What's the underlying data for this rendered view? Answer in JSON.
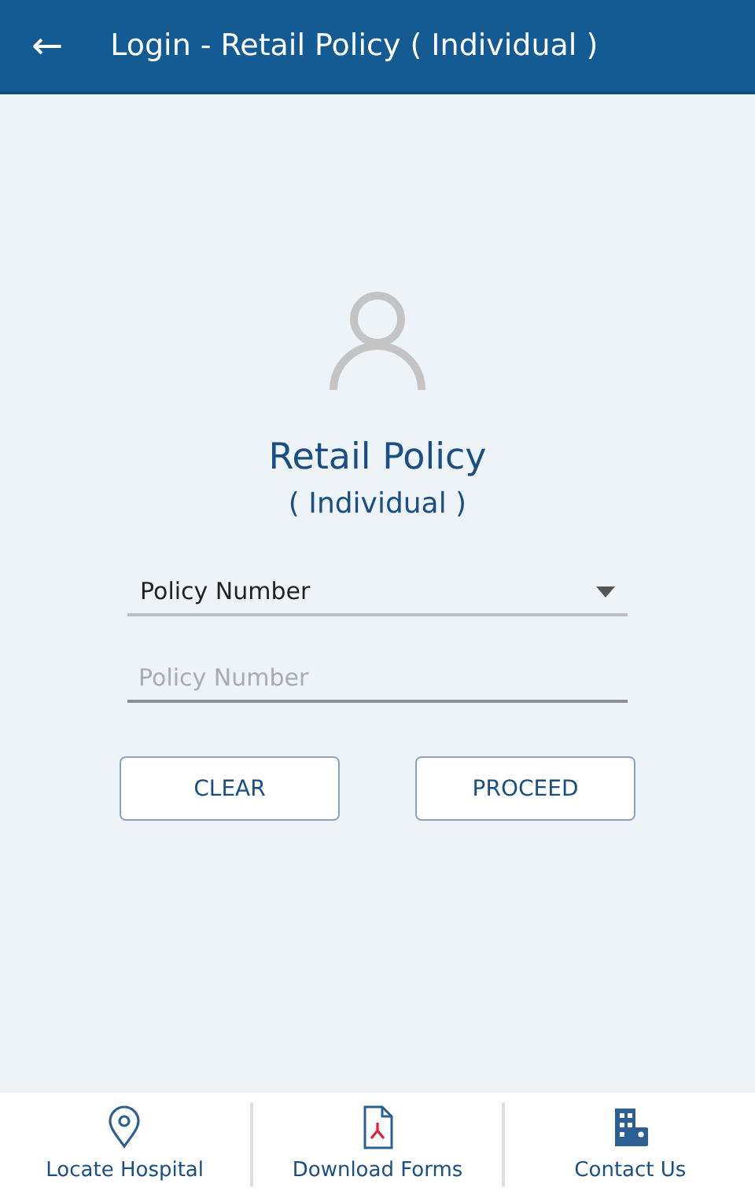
{
  "header": {
    "back_icon": "←",
    "title": "Login - Retail Policy ( Individual )"
  },
  "login": {
    "title": "Retail Policy",
    "subtitle": "( Individual )",
    "dropdown": {
      "value": "Policy Number"
    },
    "input": {
      "placeholder": "Policy Number"
    },
    "buttons": [
      "CLEAR",
      "PROCEED"
    ]
  },
  "bottom_nav": [
    {
      "kind": "location",
      "label": "Locate Hospital"
    },
    {
      "kind": "document",
      "label": "Download Forms"
    },
    {
      "kind": "building",
      "label": "Contact Us"
    }
  ]
}
